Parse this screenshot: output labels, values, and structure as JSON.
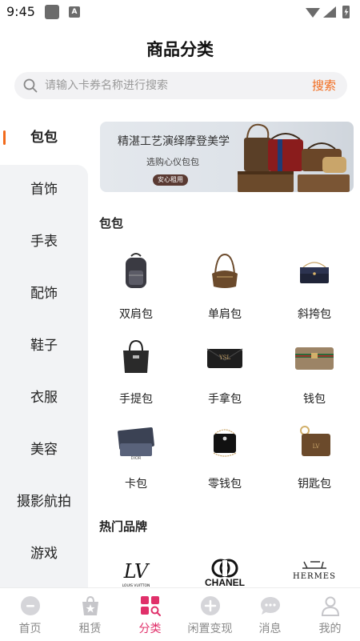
{
  "status_bar": {
    "time": "9:45",
    "app_badge": "A"
  },
  "page": {
    "title": "商品分类"
  },
  "search": {
    "placeholder": "请输入卡券名称进行搜索",
    "button": "搜索"
  },
  "sidebar": {
    "items": [
      {
        "label": "包包",
        "active": true
      },
      {
        "label": "首饰"
      },
      {
        "label": "手表"
      },
      {
        "label": "配饰"
      },
      {
        "label": "鞋子"
      },
      {
        "label": "衣服"
      },
      {
        "label": "美容"
      },
      {
        "label": "摄影航拍"
      },
      {
        "label": "游戏"
      }
    ]
  },
  "banner": {
    "headline": "精湛工艺演绎摩登美学",
    "subline": "选购心仪包包",
    "tag": "安心租用"
  },
  "section_bags": {
    "title": "包包",
    "items": [
      {
        "label": "双肩包",
        "icon": "backpack-icon"
      },
      {
        "label": "单肩包",
        "icon": "shoulder-bag-icon"
      },
      {
        "label": "斜挎包",
        "icon": "crossbody-bag-icon"
      },
      {
        "label": "手提包",
        "icon": "handbag-icon"
      },
      {
        "label": "手拿包",
        "icon": "clutch-icon"
      },
      {
        "label": "钱包",
        "icon": "wallet-icon"
      },
      {
        "label": "卡包",
        "icon": "card-holder-icon"
      },
      {
        "label": "零钱包",
        "icon": "coin-purse-icon"
      },
      {
        "label": "钥匙包",
        "icon": "key-pouch-icon"
      }
    ]
  },
  "section_brands": {
    "title": "热门品牌",
    "brands": [
      {
        "logo_text": "LV",
        "sub": "LOUIS VUITTON"
      },
      {
        "logo_text": "CHANEL"
      },
      {
        "logo_text": "HERMES"
      }
    ]
  },
  "tabbar": {
    "tabs": [
      {
        "label": "首页",
        "icon": "home-icon"
      },
      {
        "label": "租赁",
        "icon": "rent-bag-icon"
      },
      {
        "label": "分类",
        "icon": "category-icon",
        "active": true
      },
      {
        "label": "闲置变现",
        "icon": "plus-circle-icon"
      },
      {
        "label": "消息",
        "icon": "message-icon"
      },
      {
        "label": "我的",
        "icon": "profile-icon"
      }
    ]
  },
  "colors": {
    "accent": "#f26a1b",
    "tab_active": "#e0306a",
    "sidebar_bg": "#f2f3f5"
  }
}
